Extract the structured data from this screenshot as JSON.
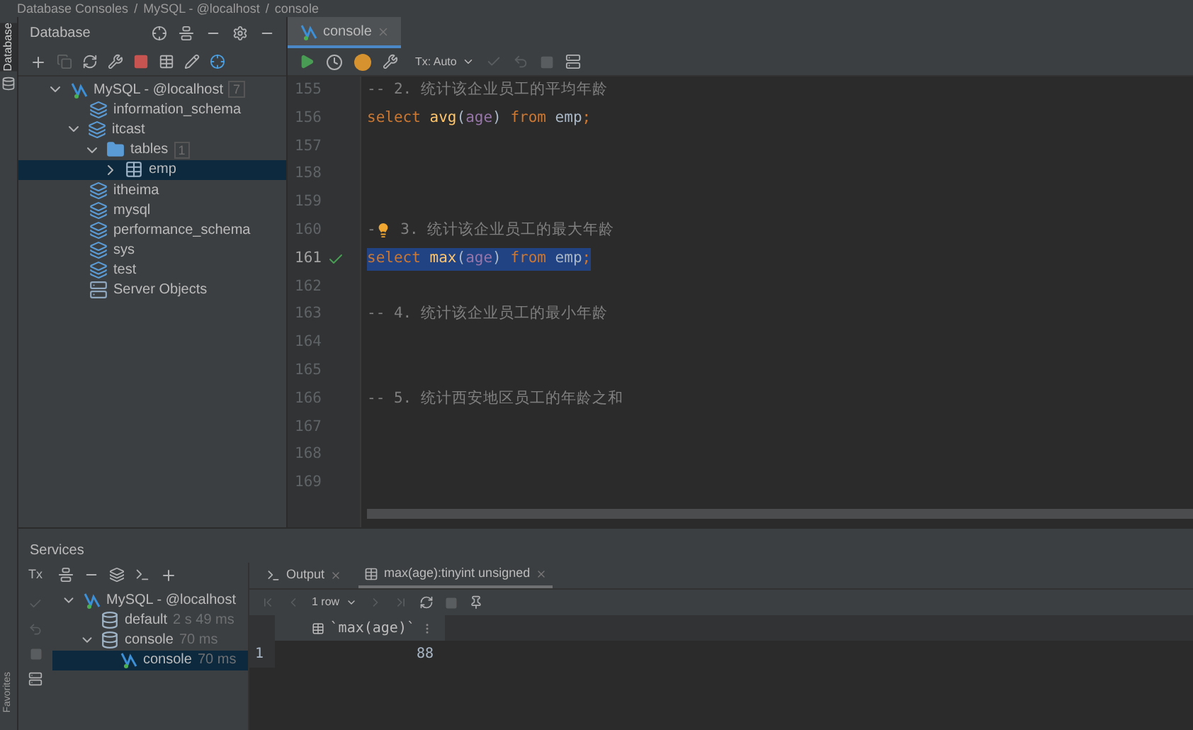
{
  "breadcrumb": [
    {
      "label": "Database Consoles"
    },
    {
      "separator": "/",
      "label": "MySQL - @localhost"
    },
    {
      "separator": "/",
      "label": "console"
    }
  ],
  "side_strip": {
    "top_label": "Database",
    "bottom_label": "Favorites"
  },
  "database_panel": {
    "title": "Database",
    "tree": [
      {
        "kind": "connection",
        "label": "MySQL - @localhost",
        "badge": "7",
        "expanded": true,
        "selected": false,
        "children": [
          {
            "kind": "schema",
            "label": "information_schema",
            "expanded": false,
            "selected": false
          },
          {
            "kind": "schema",
            "label": "itcast",
            "expanded": true,
            "selected": false,
            "children": [
              {
                "kind": "folder",
                "label": "tables",
                "badge": "1",
                "expanded": true,
                "selected": false,
                "children": [
                  {
                    "kind": "table",
                    "label": "emp",
                    "expanded": false,
                    "selected": true
                  }
                ]
              }
            ]
          },
          {
            "kind": "schema",
            "label": "itheima",
            "expanded": false,
            "selected": false
          },
          {
            "kind": "schema",
            "label": "mysql",
            "expanded": false,
            "selected": false
          },
          {
            "kind": "schema",
            "label": "performance_schema",
            "expanded": false,
            "selected": false
          },
          {
            "kind": "schema",
            "label": "sys",
            "expanded": false,
            "selected": false
          },
          {
            "kind": "schema",
            "label": "test",
            "expanded": false,
            "selected": false
          },
          {
            "kind": "server",
            "label": "Server Objects",
            "expanded": false,
            "selected": false
          }
        ]
      }
    ]
  },
  "editor": {
    "tabs": [
      {
        "label": "console",
        "selected": true
      }
    ],
    "tx_mode": "Tx: Auto",
    "lines": [
      {
        "number": "155",
        "current": false,
        "check": false,
        "selected": false,
        "tokens": [
          {
            "kind": "comment",
            "text": "-- 2. 统计该企业员工的平均年龄"
          }
        ]
      },
      {
        "number": "156",
        "current": false,
        "check": false,
        "selected": false,
        "tokens": [
          {
            "kind": "keyword",
            "text": "select "
          },
          {
            "kind": "function",
            "text": "avg"
          },
          {
            "kind": "plain",
            "text": "("
          },
          {
            "kind": "column",
            "text": "age"
          },
          {
            "kind": "plain",
            "text": ") "
          },
          {
            "kind": "keyword",
            "text": "from "
          },
          {
            "kind": "plain",
            "text": "emp"
          },
          {
            "kind": "keyword",
            "text": ";"
          }
        ]
      },
      {
        "number": "157",
        "current": false,
        "check": false,
        "selected": false
      },
      {
        "number": "158",
        "current": false,
        "check": false,
        "selected": false
      },
      {
        "number": "159",
        "current": false,
        "check": false,
        "selected": false
      },
      {
        "number": "160",
        "current": false,
        "check": false,
        "selected": false,
        "tokens": [
          {
            "kind": "comment",
            "text": "-"
          },
          {
            "kind": "bulb"
          },
          {
            "kind": "comment",
            "text": " 3. 统计该企业员工的最大年龄"
          }
        ]
      },
      {
        "number": "161",
        "current": true,
        "check": true,
        "selected": true,
        "tokens": [
          {
            "kind": "keyword",
            "text": "select "
          },
          {
            "kind": "function",
            "text": "max"
          },
          {
            "kind": "plain",
            "text": "("
          },
          {
            "kind": "column",
            "text": "age"
          },
          {
            "kind": "plain",
            "text": ") "
          },
          {
            "kind": "keyword",
            "text": "from "
          },
          {
            "kind": "plain",
            "text": "emp"
          },
          {
            "kind": "keyword",
            "text": ";"
          }
        ]
      },
      {
        "number": "162",
        "current": false,
        "check": false,
        "selected": false
      },
      {
        "number": "163",
        "current": false,
        "check": false,
        "selected": false,
        "tokens": [
          {
            "kind": "comment",
            "text": "-- 4. 统计该企业员工的最小年龄"
          }
        ]
      },
      {
        "number": "164",
        "current": false,
        "check": false,
        "selected": false
      },
      {
        "number": "165",
        "current": false,
        "check": false,
        "selected": false
      },
      {
        "number": "166",
        "current": false,
        "check": false,
        "selected": false,
        "tokens": [
          {
            "kind": "comment",
            "text": "-- 5. 统计西安地区员工的年龄之和"
          }
        ]
      },
      {
        "number": "167",
        "current": false,
        "check": false,
        "selected": false
      },
      {
        "number": "168",
        "current": false,
        "check": false,
        "selected": false
      },
      {
        "number": "169",
        "current": false,
        "check": false,
        "selected": false
      }
    ]
  },
  "services": {
    "title": "Services",
    "tx_label": "Tx",
    "tree": [
      {
        "label": "MySQL - @localhost",
        "kind": "connection",
        "expanded": true,
        "selected": false,
        "children": [
          {
            "label": "default",
            "kind": "session",
            "time": "2 s 49 ms",
            "expanded": false,
            "selected": false
          },
          {
            "label": "console",
            "kind": "session",
            "time": "70 ms",
            "expanded": true,
            "selected": false,
            "children": [
              {
                "label": "console",
                "kind": "console",
                "time": "70 ms",
                "expanded": false,
                "selected": true
              }
            ]
          }
        ]
      }
    ],
    "result_tabs": [
      {
        "label": "Output",
        "kind": "output",
        "selected": false
      },
      {
        "label": "max(age):tinyint unsigned",
        "kind": "grid",
        "selected": true
      }
    ],
    "row_count": "1 row",
    "grid": {
      "columns": [
        "`max(age)`"
      ],
      "rows": [
        {
          "number": "1",
          "cells": [
            "88"
          ]
        }
      ]
    }
  }
}
